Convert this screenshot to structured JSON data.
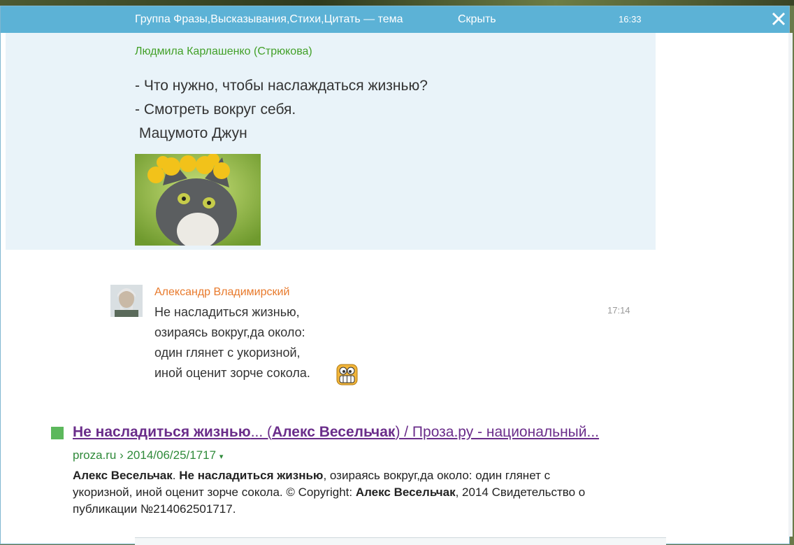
{
  "header": {
    "title": "Группа Фразы,Высказывания,Стихи,Цитать — тема",
    "hide_label": "Скрыть",
    "time": "16:33"
  },
  "post": {
    "author": "Людмила Карлашенко (Стрюкова)",
    "lines": [
      "- Что нужно, чтобы наслаждаться жизнью?",
      "- Смотреть вокруг себя.",
      " Мацумото Джун"
    ]
  },
  "comment": {
    "author": "Александр Владимирский",
    "time": "17:14",
    "lines": [
      "Не насладиться жизнью,",
      "озираясь вокруг,да около:",
      "один глянет с укоризной,",
      "иной оценит зорче сокола."
    ]
  },
  "search_result": {
    "title_bold_1": "Не насладиться жизнью",
    "title_part_2": "... (",
    "title_bold_2": "Алекс Весельчак",
    "title_part_3": ") / Проза.ру - национальный...",
    "url": "proza.ru › 2014/06/25/1717",
    "url_arrow": "▾",
    "snippet_bold_1": "Алекс Весельчак",
    "snippet_part_1": ". ",
    "snippet_bold_2": "Не насладиться жизнью",
    "snippet_part_2": ", озираясь вокруг,да около: один глянет с укоризной, иной оценит зорче сокола. © Copyright: ",
    "snippet_bold_3": "Алекс Весельчак",
    "snippet_part_3": ", 2014 Свидетельство о публикации №214062501717."
  },
  "colors": {
    "header_bg": "#5cb2d6",
    "post_bg": "#e9f3f9",
    "post_author": "#42a028",
    "comment_author": "#e87a2c",
    "link": "#6a2d8a",
    "url": "#2f8a3a"
  },
  "icons": {
    "close": "close-icon",
    "avatar": "avatar",
    "smiley": "grinning-smiley-icon",
    "square": "green-square-icon"
  }
}
